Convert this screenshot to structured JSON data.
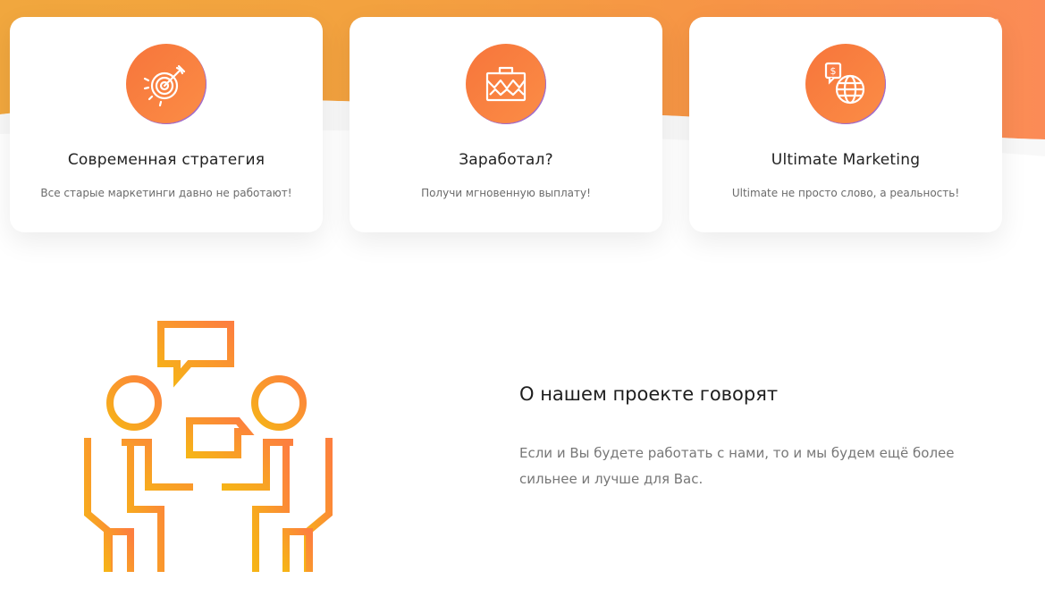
{
  "features": [
    {
      "icon": "target-icon",
      "title": "Современная стратегия",
      "text": "Все старые маркетинги давно не работают!"
    },
    {
      "icon": "briefcase-chart-icon",
      "title": "Заработал?",
      "text": "Получи мгновенную выплату!"
    },
    {
      "icon": "globe-dollar-icon",
      "title": "Ultimate Marketing",
      "text": "Ultimate не просто слово, а реальность!"
    }
  ],
  "about": {
    "title": "О нашем проекте говорят",
    "text": "Если и Вы будете работать с нами, то и мы будем ещё более сильнее и лучше для Вас.",
    "illustration": "discussion-illustration"
  },
  "colors": {
    "accent": "#f97d45",
    "hero_left": "#f1a73e",
    "hero_right": "#fb8b56",
    "gradient_yellow": "#f6b417",
    "gradient_orange": "#fd7f3f"
  }
}
